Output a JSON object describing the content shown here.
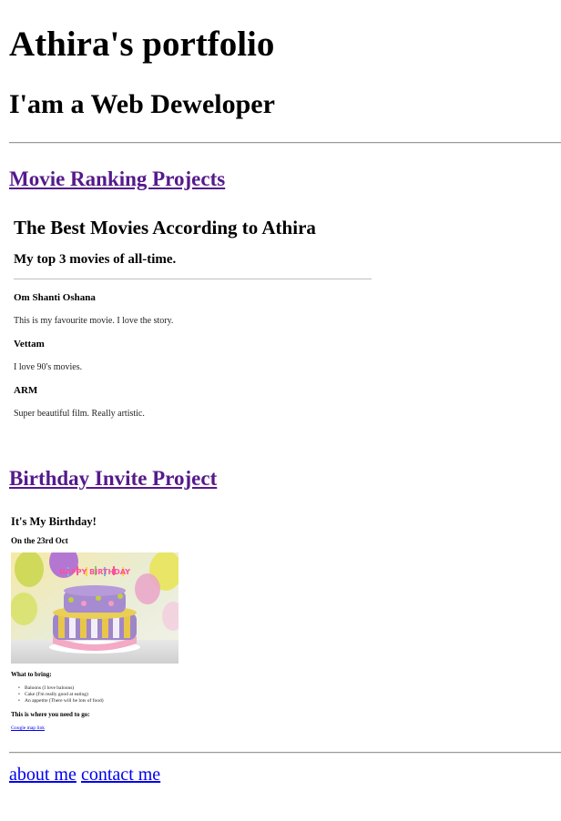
{
  "header": {
    "title": "Athira's portfolio",
    "role": "I'am a Web Deweloper"
  },
  "projects": {
    "movie_link": "Movie Ranking Projects",
    "birthday_link": "Birthday Invite Project"
  },
  "movie_page": {
    "title": "The Best Movies According to Athira",
    "subtitle": "My top 3 movies of all-time.",
    "movies": [
      {
        "name": "Om Shanti Oshana",
        "description": "This is my favourite movie. I love the story."
      },
      {
        "name": "Vettam",
        "description": "I love 90's movies."
      },
      {
        "name": "ARM",
        "description": "Super beautiful film. Really artistic."
      }
    ]
  },
  "birthday_page": {
    "title": "It's My Birthday!",
    "date": "On the 23rd Oct",
    "cake_banner_letters": "HAPPY BIRTHDAY",
    "bring_heading": "What to bring:",
    "bring_items": [
      "Baloons (I love baloons)",
      "Cake (I'm really good at eating)",
      "An appetite (There will be lots of food)"
    ],
    "where_heading": "This is where you need to go:",
    "map_link": "Google map link"
  },
  "footer": {
    "about": "about me",
    "contact": "contact me"
  },
  "colors": {
    "visited_link": "#551a8b",
    "link": "#0000ee"
  }
}
